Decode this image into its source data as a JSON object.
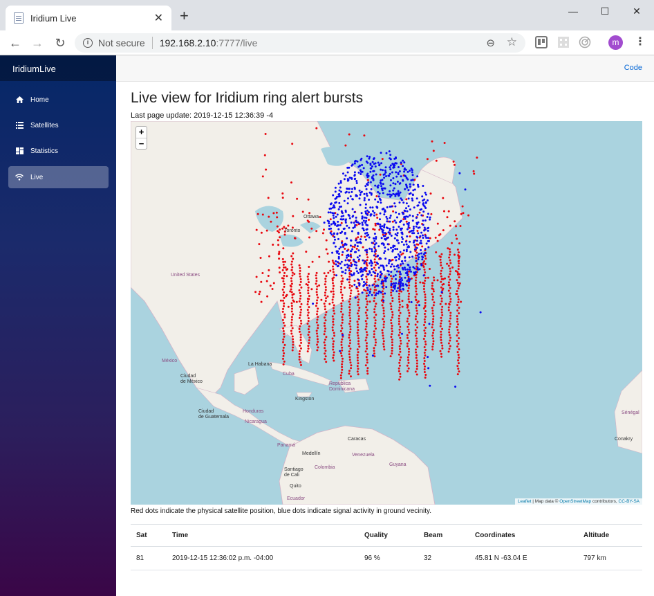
{
  "browser": {
    "tab_title": "Iridium Live",
    "new_tab": "+",
    "security_label": "Not secure",
    "url_host": "192.168.2.10",
    "url_path": ":7777/live",
    "avatar_letter": "m",
    "minimize": "—",
    "maximize": "☐",
    "close": "✕"
  },
  "sidebar": {
    "brand": "IridiumLive",
    "items": [
      {
        "label": "Home",
        "icon": "home-icon"
      },
      {
        "label": "Satellites",
        "icon": "list-icon"
      },
      {
        "label": "Statistics",
        "icon": "dashboard-icon"
      },
      {
        "label": "Live",
        "icon": "wifi-icon",
        "active": true
      }
    ]
  },
  "topbar": {
    "code_link": "Code"
  },
  "main": {
    "title": "Live view for Iridium ring alert bursts",
    "last_update": "Last page update: 2019-12-15 12:36:39 -4",
    "caption": "Red dots indicate the physical satellite position, blue dots indicate signal activity in ground vecinity."
  },
  "map": {
    "zoom_in": "+",
    "zoom_out": "−",
    "attribution_leaflet": "Leaflet",
    "attribution_mid": " | Map data © ",
    "attribution_osm": "OpenStreetMap",
    "attribution_contrib": " contributors, ",
    "attribution_license": "CC-BY-SA",
    "labels": {
      "ottawa": "Ottawa",
      "toronto": "Toronto",
      "united_states": "United States",
      "mexico": "México",
      "la_habana": "La Habana",
      "cuba": "Cuba",
      "ciudad_mexico": "Ciudad\nde México",
      "republica_dominicana": "República\nDominicana",
      "kingston": "Kingston",
      "honduras": "Honduras",
      "guatemala": "Ciudad\nde Guatemala",
      "nicaragua": "Nicaragua",
      "caracas": "Caracas",
      "venezuela": "Venezuela",
      "medellin": "Medellín",
      "panama": "Panamá",
      "guyana": "Guyana",
      "colombia": "Colombia",
      "santiago_cali": "Santiago\nde Cali",
      "quito": "Quito",
      "ecuador": "Ecuador",
      "senegal": "Sénégal",
      "conakry": "Conakry"
    },
    "colors": {
      "satellite": "#e8080f",
      "signal": "#0b0bf0",
      "water": "#aad3df",
      "land": "#f2efe9"
    }
  },
  "table": {
    "headers": {
      "sat": "Sat",
      "time": "Time",
      "quality": "Quality",
      "beam": "Beam",
      "coordinates": "Coordinates",
      "altitude": "Altitude"
    },
    "rows": [
      {
        "sat": "81",
        "time": "2019-12-15 12:36:02 p.m. -04:00",
        "quality": "96 %",
        "beam": "32",
        "coordinates": "45.81 N -63.04 E",
        "altitude": "797 km"
      }
    ]
  }
}
